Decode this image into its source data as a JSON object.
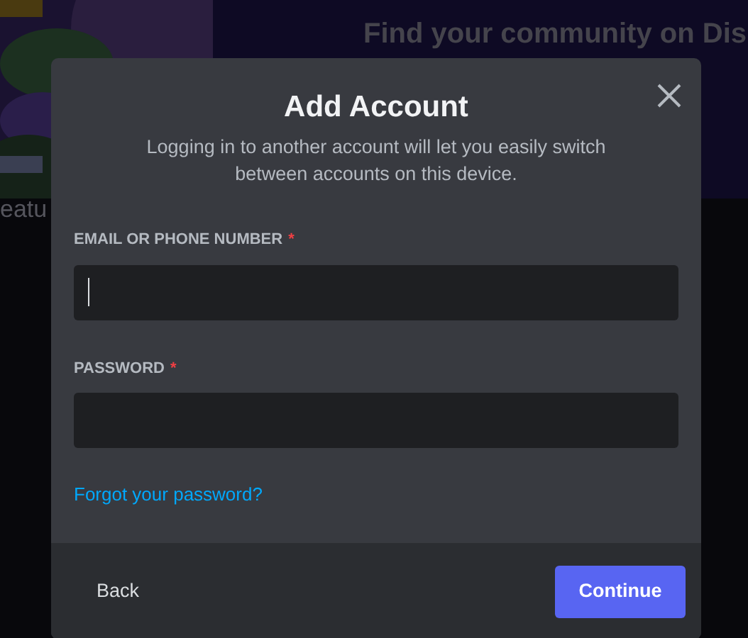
{
  "background": {
    "heading": "Find your community on Dis",
    "section_label": "eatu"
  },
  "dialog": {
    "title": "Add Account",
    "subtitle": "Logging in to another account will let you easily switch between accounts on this device.",
    "fields": [
      {
        "label": "EMAIL OR PHONE NUMBER",
        "required_mark": "*",
        "focused": true
      },
      {
        "label": "PASSWORD",
        "required_mark": "*",
        "focused": false
      }
    ],
    "link": "Forgot your password?",
    "buttons": [
      {
        "label": "Back",
        "kind": "link"
      },
      {
        "label": "Continue",
        "kind": "primary"
      }
    ]
  }
}
